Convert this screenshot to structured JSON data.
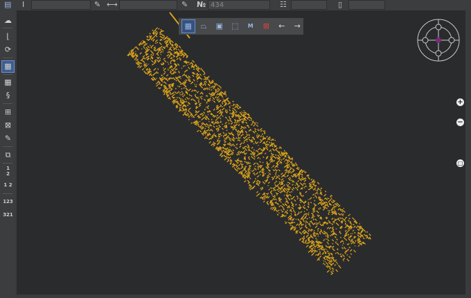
{
  "topbar": {
    "number_label": "№",
    "number_value": "434",
    "fields": [
      "",
      "",
      "",
      "",
      ""
    ]
  },
  "left_toolbar": {
    "items": [
      "file",
      "cloud-settings",
      "axes",
      "rotate",
      "select-area",
      "grid",
      "align",
      "add-region",
      "remove-region",
      "edit-region",
      "overlap",
      "fraction",
      "1 2",
      "123",
      "321"
    ],
    "labels": {
      "fraction_top": "1",
      "fraction_bottom": "2",
      "n12": "1 2",
      "n123": "123",
      "n321": "321"
    }
  },
  "floating_toolbar": {
    "items": [
      "select-rect",
      "select-perspective",
      "select-inner",
      "select-dashed",
      "select-m",
      "clear-selection",
      "arrow-left",
      "arrow-right"
    ],
    "m_label": "M"
  },
  "zoom": {
    "in": "+",
    "out": "−",
    "fit": "□"
  },
  "colors": {
    "points": "#d9a21b",
    "accent": "#3e5d8c",
    "canvas": "#2a2b2d"
  }
}
